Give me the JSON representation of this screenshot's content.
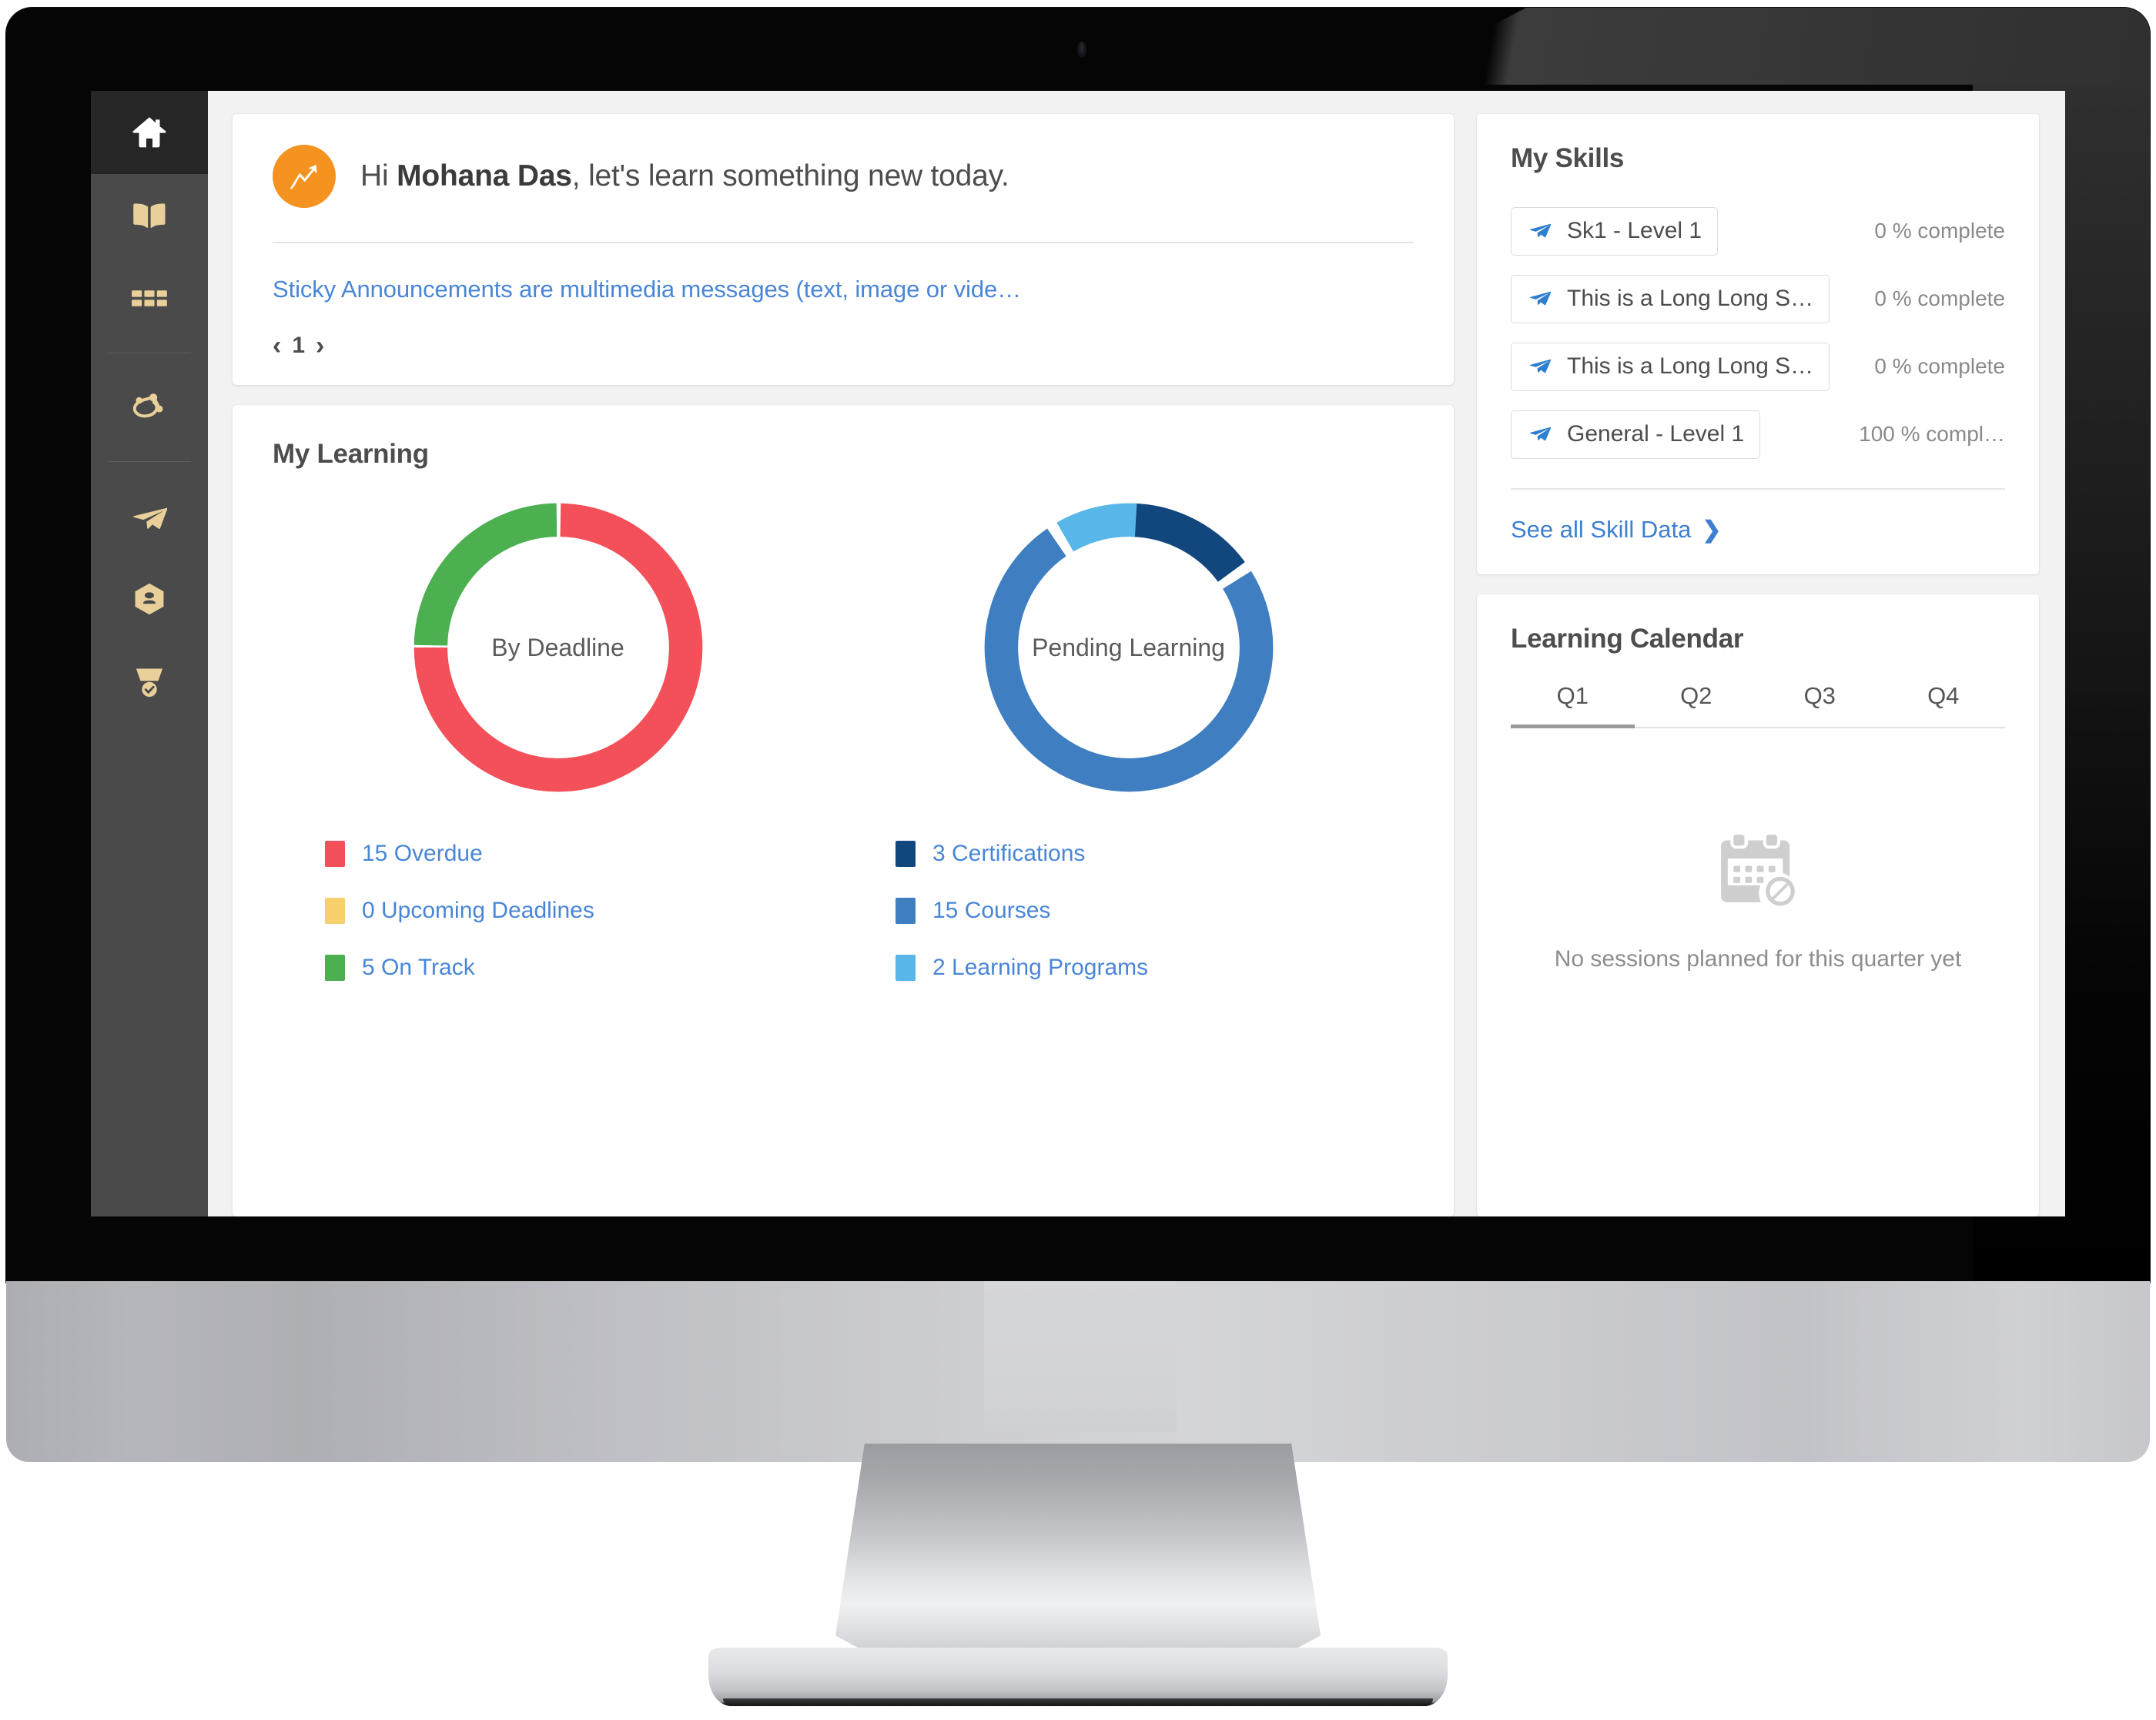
{
  "sidebar": {
    "items": [
      {
        "icon": "home-icon",
        "name": "home",
        "active": true
      },
      {
        "icon": "book-icon",
        "name": "catalog",
        "active": false
      },
      {
        "icon": "grid-icon",
        "name": "apps",
        "active": false
      },
      {
        "icon": "network-icon",
        "name": "social",
        "active": false
      },
      {
        "icon": "paper-plane-icon",
        "name": "skills",
        "active": false
      },
      {
        "icon": "hexagon-badge-icon",
        "name": "badges",
        "active": false
      },
      {
        "icon": "award-check-icon",
        "name": "certificates",
        "active": false
      }
    ]
  },
  "greeting": {
    "prefix": "Hi ",
    "name": "Mohana Das",
    "suffix": ", let's learn something new today.",
    "avatar_icon": "growth-arrow-icon",
    "avatar_color": "#f59320"
  },
  "announcement": {
    "text": "Sticky Announcements are multimedia messages (text, image or vide…",
    "prev_label": "‹",
    "page": "1",
    "next_label": "›"
  },
  "my_learning": {
    "title": "My Learning"
  },
  "my_skills": {
    "title": "My Skills",
    "items": [
      {
        "name": "Sk1 - Level 1",
        "progress": "0 % complete"
      },
      {
        "name": "This is a Long Long S…",
        "progress": "0 % complete"
      },
      {
        "name": "This is a Long Long S…",
        "progress": "0 % complete"
      },
      {
        "name": "General - Level 1",
        "progress": "100 % compl…"
      }
    ],
    "see_all_label": "See all Skill Data",
    "chevron": "❯"
  },
  "learning_calendar": {
    "title": "Learning Calendar",
    "tabs": [
      {
        "label": "Q1",
        "active": true
      },
      {
        "label": "Q2",
        "active": false
      },
      {
        "label": "Q3",
        "active": false
      },
      {
        "label": "Q4",
        "active": false
      }
    ],
    "empty_icon": "calendar-disabled-icon",
    "empty_text": "No sessions planned for this quarter yet"
  },
  "chart_data": [
    {
      "type": "pie",
      "title": "By Deadline",
      "center_label": "By Deadline",
      "categories": [
        "15 Overdue",
        "0 Upcoming Deadlines",
        "5 On Track"
      ],
      "values": [
        15,
        0,
        5
      ],
      "colors": [
        "#f4505a",
        "#f7cf6b",
        "#4caf50"
      ],
      "legend_position": "bottom-left",
      "total": 20
    },
    {
      "type": "pie",
      "title": "Pending Learning",
      "center_label": "Pending Learning",
      "categories": [
        "3 Certifications",
        "15 Courses",
        "2 Learning Programs"
      ],
      "values": [
        3,
        15,
        2
      ],
      "colors": [
        "#12477e",
        "#3f7fc1",
        "#58b6e8"
      ],
      "legend_position": "bottom-left",
      "total": 20
    }
  ]
}
